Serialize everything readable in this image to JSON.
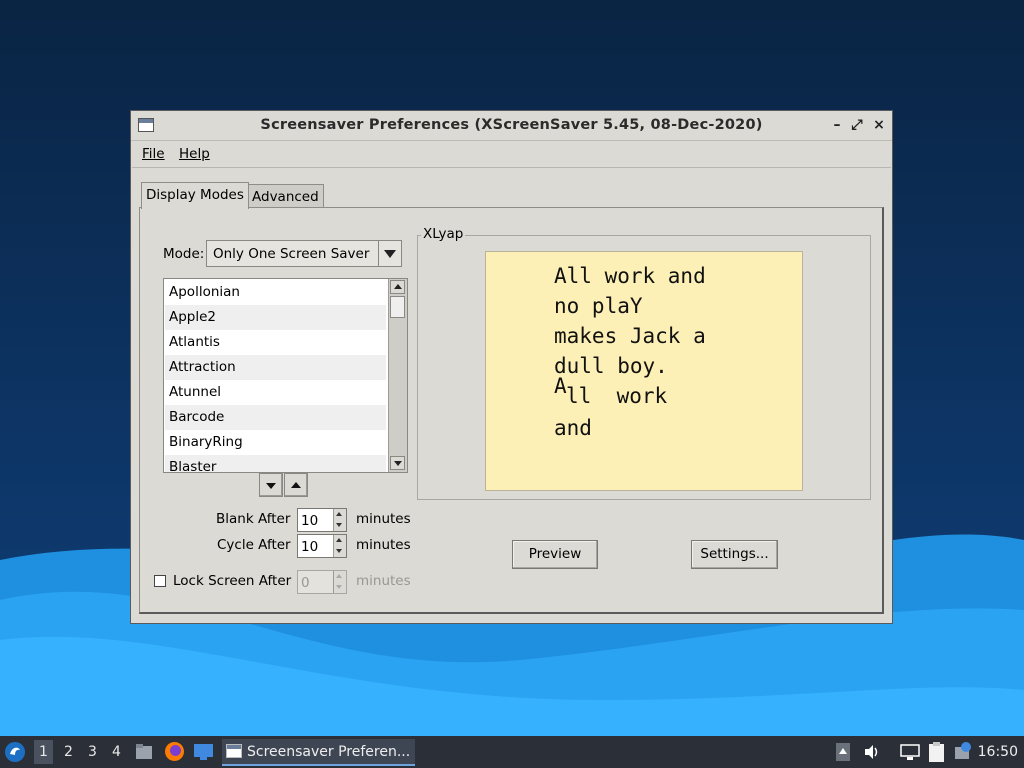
{
  "window": {
    "title": "Screensaver Preferences  (XScreenSaver 5.45, 08-Dec-2020)",
    "controls": {
      "minimize": "–",
      "maximize": "⤢",
      "close": "×"
    }
  },
  "menu": {
    "file": "File",
    "help": "Help"
  },
  "tabs": [
    {
      "label": "Display Modes",
      "active": true
    },
    {
      "label": "Advanced",
      "active": false
    }
  ],
  "mode": {
    "label": "Mode:",
    "value": "Only One Screen Saver"
  },
  "savers": [
    "Apollonian",
    "Apple2",
    "Atlantis",
    "Attraction",
    "Atunnel",
    "Barcode",
    "BinaryRing",
    "Blaster"
  ],
  "timing": {
    "blank_label": "Blank After",
    "blank_value": "10",
    "cycle_label": "Cycle After",
    "cycle_value": "10",
    "lock_label": "Lock Screen After",
    "lock_value": "0",
    "lock_checked": false,
    "unit": "minutes"
  },
  "preview": {
    "frame_label": "XLyap",
    "lines": [
      "All work and",
      "no plaY",
      "makes Jack a",
      "dull boy.",
      "ll  work",
      "and"
    ],
    "stray_char": "A",
    "background": "#fdf0b6"
  },
  "buttons": {
    "preview": "Preview",
    "settings": "Settings..."
  },
  "taskbar": {
    "workspaces": [
      "1",
      "2",
      "3",
      "4"
    ],
    "active_workspace": "1",
    "task_label": "Screensaver Preferen...",
    "clock": "16:50"
  }
}
